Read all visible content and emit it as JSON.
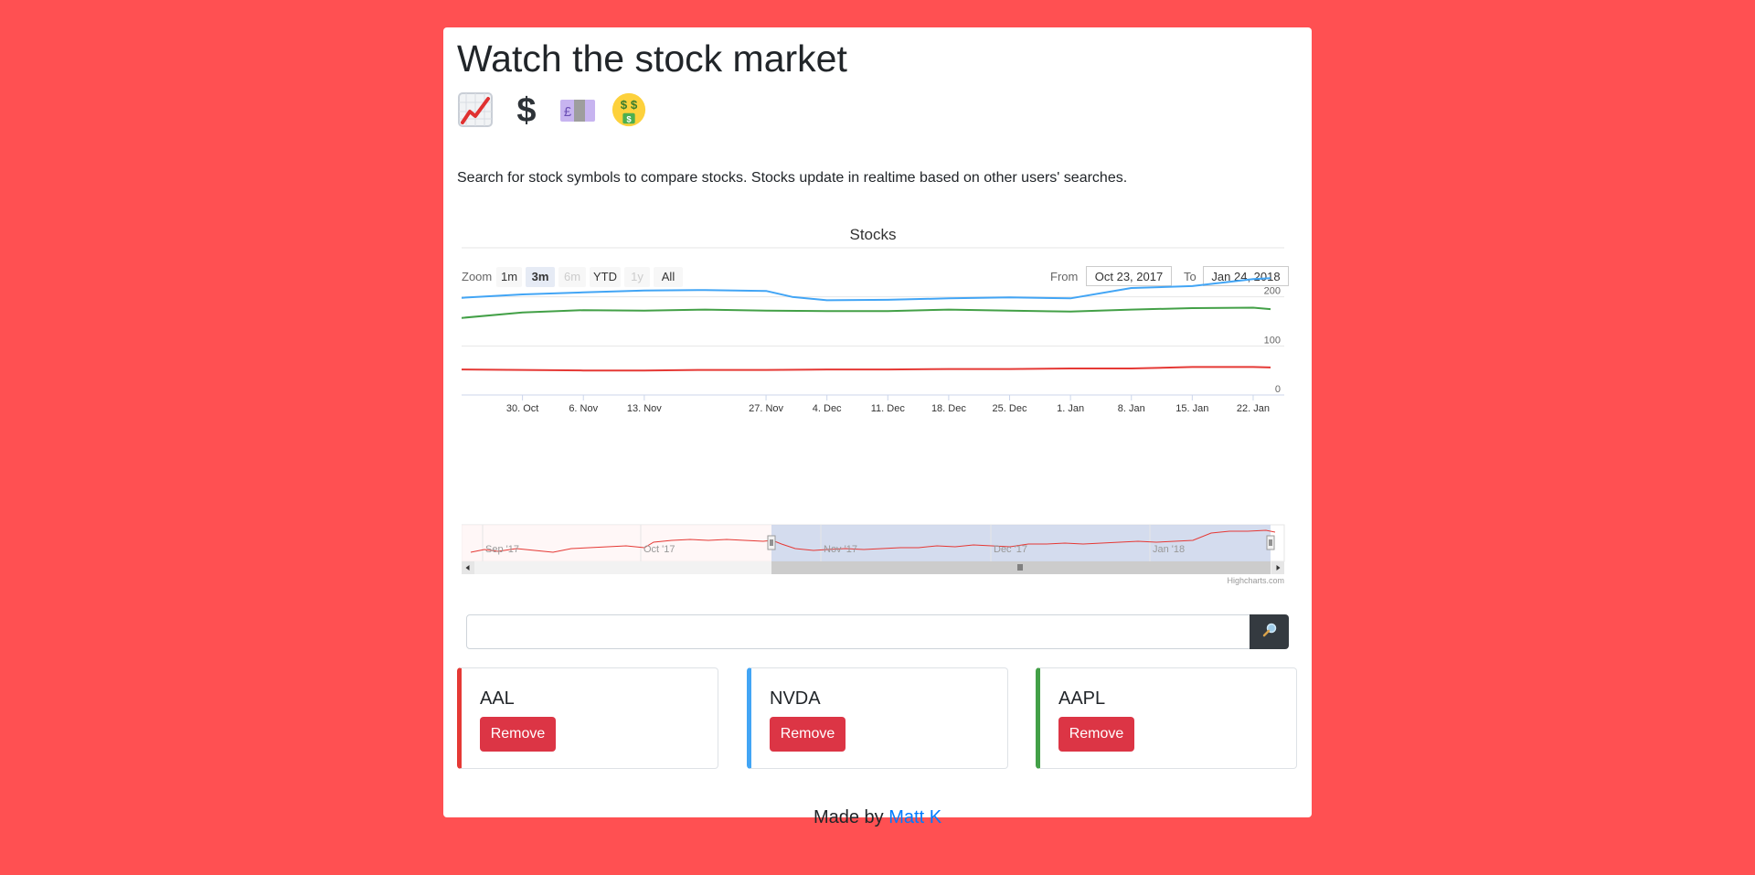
{
  "header": {
    "title": "Watch the stock market",
    "emojis": [
      "chart-increasing-icon",
      "dollar-sign-icon",
      "pound-banknote-icon",
      "money-mouth-face-icon"
    ],
    "description": "Search for stock symbols to compare stocks. Stocks update in realtime based on other users' searches."
  },
  "chart": {
    "zoom_label": "Zoom",
    "zoom_buttons": [
      {
        "label": "1m",
        "state": "normal"
      },
      {
        "label": "3m",
        "state": "active"
      },
      {
        "label": "6m",
        "state": "disabled"
      },
      {
        "label": "YTD",
        "state": "normal"
      },
      {
        "label": "1y",
        "state": "disabled"
      },
      {
        "label": "All",
        "state": "normal"
      }
    ],
    "from_label": "From",
    "from_value": "Oct 23, 2017",
    "to_label": "To",
    "to_value": "Jan 24, 2018",
    "credit": "Highcharts.com",
    "navigator_labels": [
      "Sep '17",
      "Oct '17",
      "Nov '17",
      "Dec '17",
      "Jan '18"
    ]
  },
  "chart_data": {
    "type": "line",
    "title": "Stocks",
    "x_tick_labels": [
      "30. Oct",
      "6. Nov",
      "13. Nov",
      "27. Nov",
      "4. Dec",
      "11. Dec",
      "18. Dec",
      "25. Dec",
      "1. Jan",
      "8. Jan",
      "15. Jan",
      "22. Jan"
    ],
    "y_ticks": [
      0,
      100,
      200
    ],
    "ylim": [
      0,
      300
    ],
    "xlim": [
      "2017-10-23",
      "2018-01-24"
    ],
    "grid": true,
    "series": [
      {
        "name": "AAL",
        "color": "#e53935",
        "points": [
          [
            "2017-10-23",
            52
          ],
          [
            "2017-10-30",
            51
          ],
          [
            "2017-11-06",
            50
          ],
          [
            "2017-11-13",
            50
          ],
          [
            "2017-11-20",
            51
          ],
          [
            "2017-11-27",
            51
          ],
          [
            "2017-12-04",
            52
          ],
          [
            "2017-12-11",
            52
          ],
          [
            "2017-12-18",
            53
          ],
          [
            "2017-12-25",
            53
          ],
          [
            "2018-01-01",
            54
          ],
          [
            "2018-01-08",
            54
          ],
          [
            "2018-01-15",
            57
          ],
          [
            "2018-01-22",
            57
          ],
          [
            "2018-01-24",
            56
          ]
        ]
      },
      {
        "name": "NVDA",
        "color": "#42a5f5",
        "points": [
          [
            "2017-10-23",
            198
          ],
          [
            "2017-10-30",
            205
          ],
          [
            "2017-11-06",
            209
          ],
          [
            "2017-11-13",
            213
          ],
          [
            "2017-11-20",
            214
          ],
          [
            "2017-11-27",
            212
          ],
          [
            "2017-11-30",
            200
          ],
          [
            "2017-12-04",
            193
          ],
          [
            "2017-12-11",
            194
          ],
          [
            "2017-12-18",
            197
          ],
          [
            "2017-12-25",
            199
          ],
          [
            "2018-01-01",
            197
          ],
          [
            "2018-01-08",
            218
          ],
          [
            "2018-01-15",
            222
          ],
          [
            "2018-01-22",
            236
          ],
          [
            "2018-01-24",
            238
          ]
        ]
      },
      {
        "name": "AAPL",
        "color": "#43a047",
        "points": [
          [
            "2017-10-23",
            157
          ],
          [
            "2017-10-30",
            168
          ],
          [
            "2017-11-06",
            173
          ],
          [
            "2017-11-13",
            172
          ],
          [
            "2017-11-20",
            174
          ],
          [
            "2017-11-27",
            172
          ],
          [
            "2017-12-04",
            171
          ],
          [
            "2017-12-11",
            171
          ],
          [
            "2017-12-18",
            174
          ],
          [
            "2017-12-25",
            172
          ],
          [
            "2018-01-01",
            170
          ],
          [
            "2018-01-08",
            174
          ],
          [
            "2018-01-15",
            177
          ],
          [
            "2018-01-22",
            178
          ],
          [
            "2018-01-24",
            175
          ]
        ]
      }
    ]
  },
  "search": {
    "placeholder": ""
  },
  "stocks": [
    {
      "symbol": "AAL",
      "color": "#e53935",
      "remove_label": "Remove"
    },
    {
      "symbol": "NVDA",
      "color": "#42a5f5",
      "remove_label": "Remove"
    },
    {
      "symbol": "AAPL",
      "color": "#43a047",
      "remove_label": "Remove"
    }
  ],
  "footer": {
    "made_by": "Made by",
    "author": "Matt K"
  }
}
